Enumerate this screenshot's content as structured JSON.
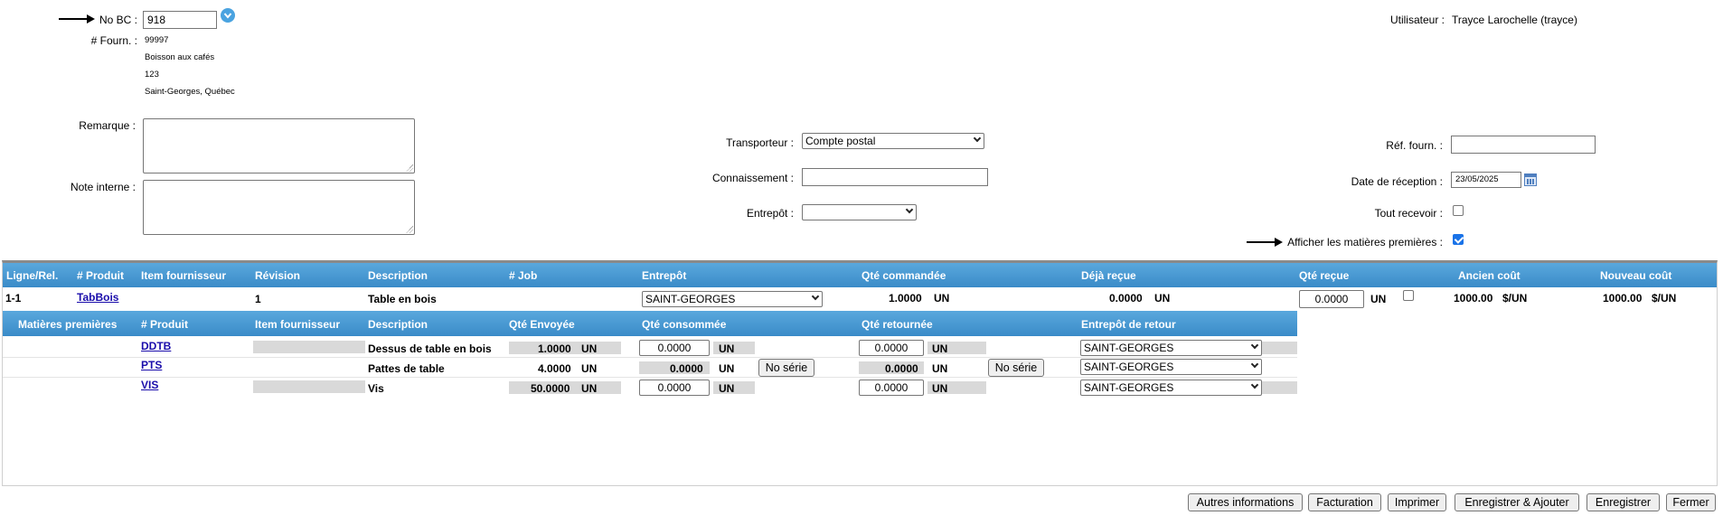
{
  "header": {
    "no_bc_label": "No BC :",
    "no_bc_value": "918",
    "fourn_label": "# Fourn. :",
    "fourn_lines": [
      "99997",
      "Boisson aux cafés",
      "123",
      "Saint-Georges, Québec"
    ],
    "user_label": "Utilisateur :",
    "user_value": "Trayce Larochelle (trayce)"
  },
  "form": {
    "remarque_label": "Remarque :",
    "note_label": "Note interne :",
    "transporteur_label": "Transporteur :",
    "transporteur_value": "Compte postal",
    "connaissement_label": "Connaissement :",
    "entrepot_label": "Entrepôt :",
    "entrepot_value": "",
    "ref_label": "Réf. fourn. :",
    "date_label": "Date de réception :",
    "date_value": "23/05/2025",
    "tout_label": "Tout recevoir :",
    "tout_checked": false,
    "afficher_label": "Afficher les matières premières :",
    "afficher_checked": true
  },
  "main_table": {
    "headers": [
      "Ligne/Rel.",
      "# Produit",
      "Item fournisseur",
      "Révision",
      "Description",
      "# Job",
      "Entrepôt",
      "Qté commandée",
      "Déjà reçue",
      "Qté reçue",
      "Ancien coût",
      "Nouveau coût"
    ],
    "row": {
      "ligne": "1-1",
      "produit": "TabBois",
      "item": "",
      "revision": "1",
      "description": "Table en bois",
      "job": "",
      "entrepot": "SAINT-GEORGES",
      "qte_commandee": "1.0000",
      "qte_commandee_unit": "UN",
      "deja_recue": "0.0000",
      "deja_recue_unit": "UN",
      "qte_recue": "0.0000",
      "qte_recue_unit": "UN",
      "ancien_cout": "1000.00",
      "ancien_cout_unit": "$/UN",
      "nouveau_cout": "1000.00",
      "nouveau_cout_unit": "$/UN"
    }
  },
  "sub_table": {
    "headers": [
      "Matières premières",
      "# Produit",
      "Item fournisseur",
      "Description",
      "Qté Envoyée",
      "Qté consommée",
      "Qté retournée",
      "Entrepôt de retour"
    ],
    "rows": [
      {
        "produit": "DDTB",
        "description": "Dessus de table en bois",
        "envoyee": "1.0000",
        "envoyee_unit": "UN",
        "consommee": "0.0000",
        "consommee_unit": "UN",
        "retournee": "0.0000",
        "retournee_unit": "UN",
        "entrepot": "SAINT-GEORGES",
        "serial": false
      },
      {
        "produit": "PTS",
        "description": "Pattes de table",
        "envoyee": "4.0000",
        "envoyee_unit": "UN",
        "consommee": "0.0000",
        "consommee_unit": "UN",
        "retournee": "0.0000",
        "retournee_unit": "UN",
        "entrepot": "SAINT-GEORGES",
        "serial": true
      },
      {
        "produit": "VIS",
        "description": "Vis",
        "envoyee": "50.0000",
        "envoyee_unit": "UN",
        "consommee": "0.0000",
        "consommee_unit": "UN",
        "retournee": "0.0000",
        "retournee_unit": "UN",
        "entrepot": "SAINT-GEORGES",
        "serial": false
      }
    ],
    "serial_label": "No série"
  },
  "buttons": {
    "autres": "Autres informations",
    "facturation": "Facturation",
    "imprimer": "Imprimer",
    "enregistrer_ajouter": "Enregistrer & Ajouter",
    "enregistrer": "Enregistrer",
    "fermer": "Fermer"
  },
  "icons": {
    "dropdown_circle": "chevron-circle-icon",
    "calendar": "calendar-icon",
    "pointer": "arrow-right-icon"
  },
  "colors": {
    "header_blue": "#3a8bc8",
    "link": "#1a0dab",
    "checkbox": "#1a73e8"
  }
}
